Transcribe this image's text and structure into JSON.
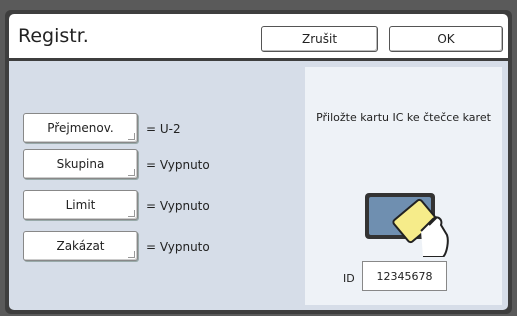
{
  "header": {
    "title": "Registr.",
    "cancel_label": "Zrušit",
    "ok_label": "OK"
  },
  "settings": [
    {
      "button": "Přejmenov.",
      "value": "= U-2"
    },
    {
      "button": "Skupina",
      "value": "= Vypnuto"
    },
    {
      "button": "Limit",
      "value": "= Vypnuto"
    },
    {
      "button": "Zakázat",
      "value": "= Vypnuto"
    }
  ],
  "card_panel": {
    "instruction": "Přiložte kartu IC ke čtečce karet",
    "id_label": "ID",
    "id_value": "12345678",
    "icon": "card-reader-hand-icon"
  },
  "colors": {
    "background": "#3e3e3e",
    "panel": "#d6dde8",
    "card": "#f6ec8a",
    "reader": "#6f8fb0"
  }
}
